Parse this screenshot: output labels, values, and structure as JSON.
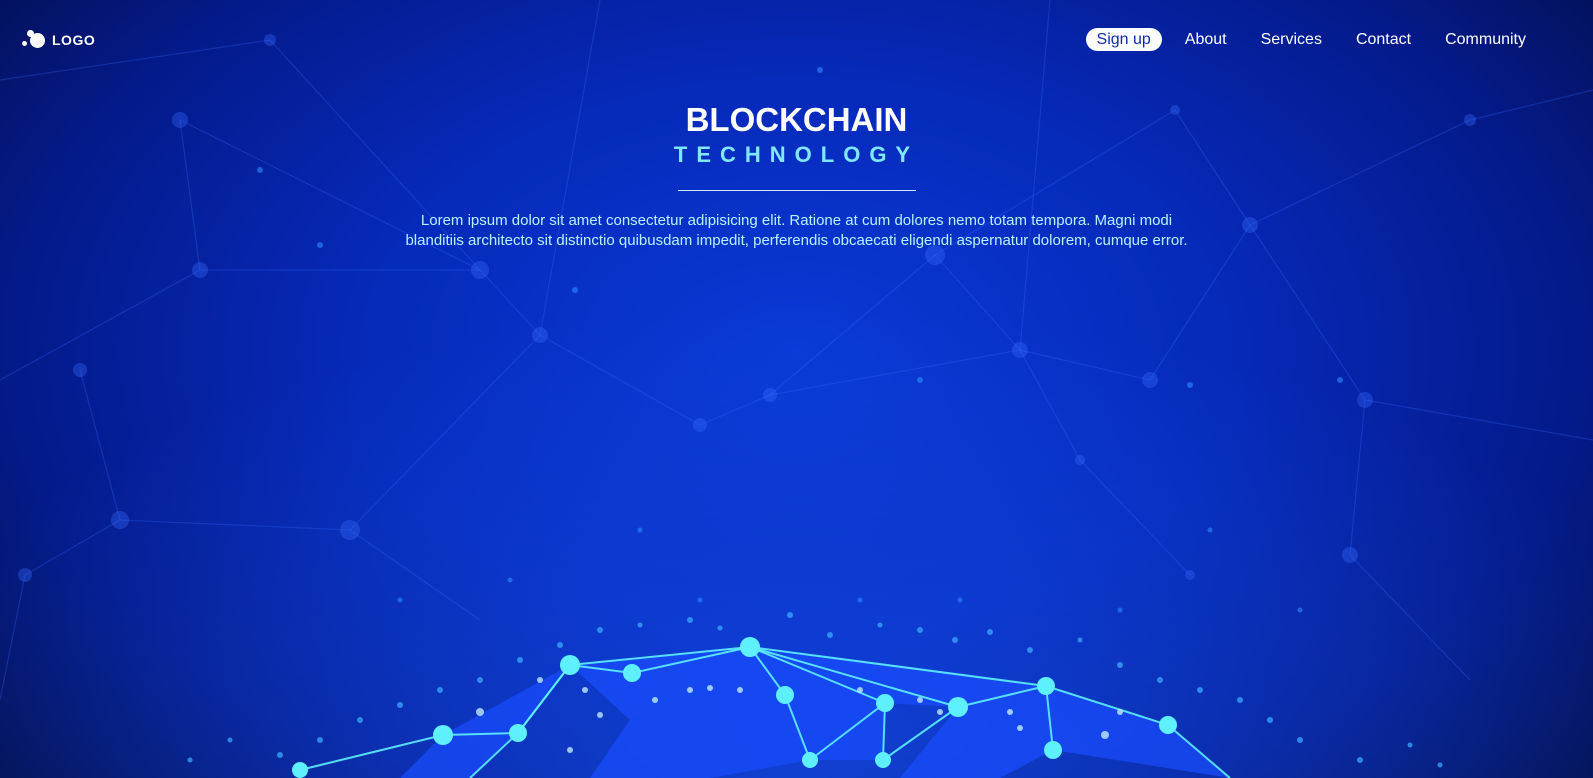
{
  "brand": {
    "logo_text": "LOGO"
  },
  "nav": {
    "items": [
      {
        "label": "Sign up",
        "active": true
      },
      {
        "label": "About",
        "active": false
      },
      {
        "label": "Services",
        "active": false
      },
      {
        "label": "Contact",
        "active": false
      },
      {
        "label": "Community",
        "active": false
      }
    ]
  },
  "hero": {
    "title": "BLOCKCHAIN",
    "subtitle": "TECHNOLOGY",
    "description": "Lorem ipsum dolor sit amet consectetur adipisicing elit. Ratione at cum dolores nemo totam tempora. Magni modi blanditiis architecto sit distinctio quibusdam impedit, perferendis obcaecati eligendi aspernatur dolorem, cumque error."
  },
  "colors": {
    "background": "#0629b8",
    "accent": "#7fe7ff",
    "node": "#5ef0ff"
  }
}
